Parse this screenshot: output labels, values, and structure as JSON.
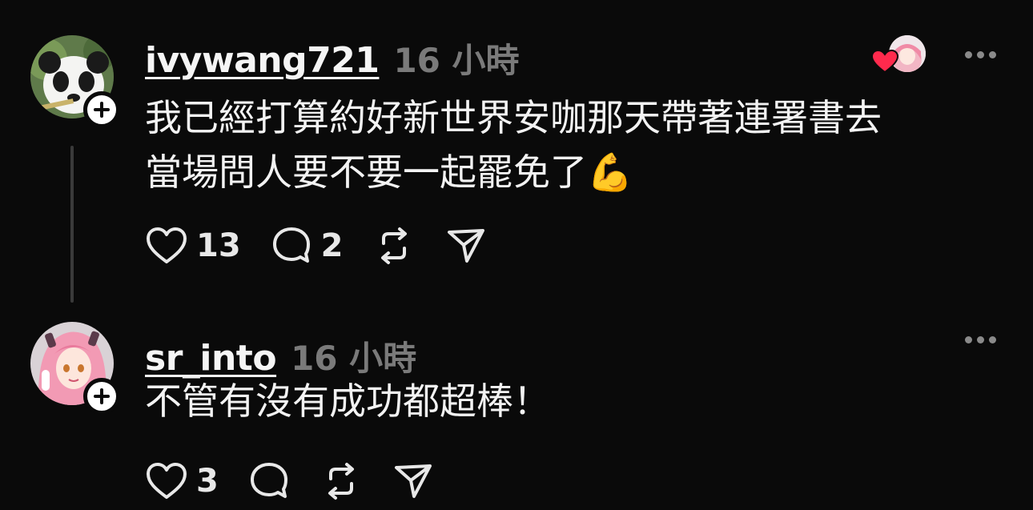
{
  "posts": [
    {
      "username": "ivywang721",
      "time": "16 小時",
      "text_line1": "我已經打算約好新世界安咖那天帶著連署書去",
      "text_line2": "當場問人要不要一起罷免了💪",
      "likes": "13",
      "replies": "2",
      "avatar_icon": "panda-avatar",
      "liked_by_icon": "heart-icon"
    },
    {
      "username": "sr_into",
      "time": "16 小時",
      "text": "不管有沒有成功都超棒！",
      "likes": "3",
      "avatar_icon": "anime-girl-avatar"
    }
  ],
  "colors": {
    "background": "#0a0a0a",
    "text": "#f3f3f3",
    "muted": "#7a7a7a",
    "heart": "#ff2a4d"
  }
}
